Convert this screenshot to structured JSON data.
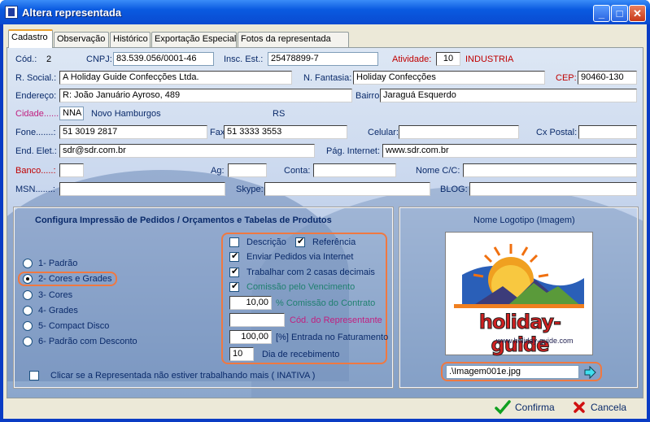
{
  "window": {
    "title": "Altera representada"
  },
  "tabs": [
    "Cadastro",
    "Observação",
    "Histórico",
    "Exportação Especial",
    "Fotos da representada"
  ],
  "fields": {
    "cod_label": "Cód.:",
    "cod_value": "2",
    "cnpj_label": "CNPJ:",
    "cnpj_value": "83.539.056/0001-46",
    "insc_label": "Insc. Est.:",
    "insc_value": "25478899-7",
    "atividade_label": "Atividade:",
    "atividade_code": "10",
    "atividade_name": "INDUSTRIA",
    "rsocial_label": "R. Social.:",
    "rsocial_value": "A Holiday Guide Confecções Ltda.",
    "nfantasia_label": "N. Fantasia:",
    "nfantasia_value": "Holiday Confecções",
    "cep_label": "CEP:",
    "cep_value": "90460-130",
    "endereco_label": "Endereço:",
    "endereco_value": "R: João Januário Ayroso, 489",
    "bairro_label": "Bairro:",
    "bairro_value": "Jaraguá Esquerdo",
    "cidade_label": "Cidade......:",
    "cidade_code": "NNA",
    "cidade_name": "Novo Hamburgos",
    "uf": "RS",
    "fone_label": "Fone.......:",
    "fone_value": "51 3019 2817",
    "fax_label": "Fax:",
    "fax_value": "51 3333 3553",
    "celular_label": "Celular:",
    "celular_value": "",
    "cxpostal_label": "Cx Postal:",
    "cxpostal_value": "",
    "endelet_label": "End. Elet.:",
    "endelet_value": "sdr@sdr.com.br",
    "paginternet_label": "Pág. Internet:",
    "paginternet_value": "www.sdr.com.br",
    "banco_label": "Banco.....:",
    "banco_value": "",
    "ag_label": "Ag:",
    "ag_value": "",
    "conta_label": "Conta:",
    "conta_value": "",
    "nomecc_label": "Nome C/C:",
    "nomecc_value": "",
    "msn_label": "MSN.......:",
    "msn_value": "",
    "skype_label": "Skype:",
    "skype_value": "",
    "blog_label": "BLOG:",
    "blog_value": ""
  },
  "print_config": {
    "title": "Configura Impressão  de Pedidos / Orçamentos  e Tabelas de Produtos",
    "radios": [
      "1- Padrão",
      "2- Cores e Grades",
      "3- Cores",
      "4- Grades",
      "5- Compact Disco",
      "6- Padrão com Desconto"
    ],
    "selected": "2- Cores e Grades",
    "options": {
      "descricao": "Descrição",
      "referencia": "Referência",
      "enviar": "Enviar Pedidos via Internet",
      "trabalhar": "Trabalhar com 2 casas decimais",
      "comissao_venc": "Comissão pelo Vencimento",
      "comissao_value": "10,00",
      "comissao_label": "% Comissão do Contrato",
      "cod_repr_value": "",
      "cod_repr_label": "Cód. do Representante",
      "entrada_value": "100,00",
      "entrada_label": "[%] Entrada no Faturamento",
      "dia_value": "10",
      "dia_label": "Dia de recebimento"
    },
    "inativa": "Clicar se a Representada não estiver trabalhando mais ( INATIVA )"
  },
  "logo": {
    "title": "Nome Logotipo (Imagem)",
    "brand": "holiday-guide",
    "url": "www.holiday-guide.com",
    "path": ".\\Imagem001e.jpg"
  },
  "actions": {
    "confirm": "Confirma",
    "cancel": "Cancela"
  },
  "colors": {
    "accent": "#f07840",
    "titlebar": "#0a5ae0"
  }
}
